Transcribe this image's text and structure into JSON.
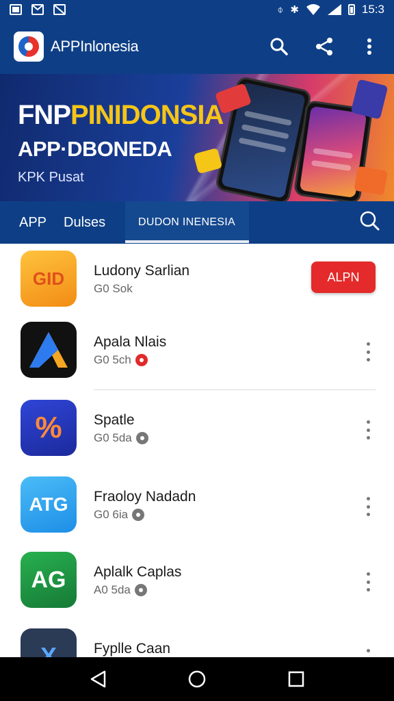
{
  "status_bar": {
    "time": "15:3"
  },
  "app_bar": {
    "title": "APPInlonesia"
  },
  "banner": {
    "headline_white": "FNP",
    "headline_yellow": "PINIDONSIA",
    "headline2": "APP·DBONEDA",
    "subtitle": "KPK Pusat"
  },
  "tabs": {
    "items": [
      "APP",
      "Dulses"
    ],
    "active": "DUDON INENESIA"
  },
  "apps": [
    {
      "name": "Ludony Sarlian",
      "meta": "G0 Sok",
      "icon_text": "GID",
      "icon_color": "#f7a51c",
      "action": "ALPN"
    },
    {
      "name": "Apala Nlais",
      "meta": "G0 5ch",
      "icon_text": "A",
      "icon_color": "#111111",
      "badge_color": "#e02b2b"
    },
    {
      "name": "Spatle",
      "meta": "G0 5da",
      "icon_text": "%",
      "icon_color": "#2a3cc7",
      "badge_color": "#777777"
    },
    {
      "name": "Fraoloy Nadadn",
      "meta": "G0 6ia",
      "icon_text": "ATG",
      "icon_color": "#2fa3f0",
      "badge_color": "#777777"
    },
    {
      "name": "Aplalk Caplas",
      "meta": "A0 5da",
      "icon_text": "AG",
      "icon_color": "#1e9b43",
      "badge_color": "#777777"
    },
    {
      "name": "Fyplle Caan",
      "meta": "",
      "icon_text": "X",
      "icon_color": "#2b3a55"
    }
  ]
}
